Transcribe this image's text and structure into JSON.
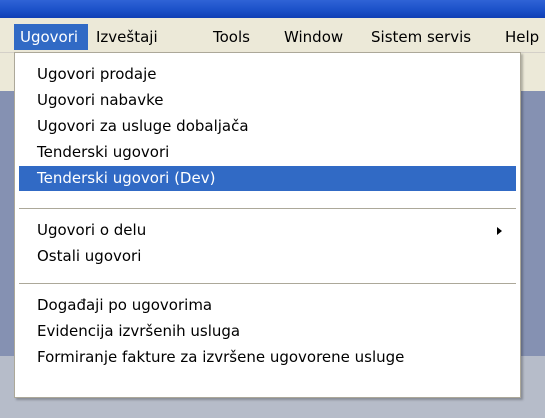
{
  "menubar": {
    "items": [
      {
        "label": "Ugovori",
        "active": true
      },
      {
        "label": "Izveštaji"
      },
      {
        "label": "Tools"
      },
      {
        "label": "Window"
      },
      {
        "label": "Sistem servis"
      },
      {
        "label": "Help"
      }
    ]
  },
  "dropdown": {
    "items": [
      {
        "label": "Ugovori prodaje"
      },
      {
        "label": "Ugovori nabavke"
      },
      {
        "label": "Ugovori za usluge dobaljača"
      },
      {
        "label": "Tenderski ugovori"
      },
      {
        "label": "Tenderski ugovori (Dev)",
        "highlighted": true
      },
      {
        "label": "Ugovori o delu",
        "submenu": true
      },
      {
        "label": "Ostali ugovori"
      },
      {
        "label": "Događaji po ugovorima"
      },
      {
        "label": "Evidencija izvršenih usluga"
      },
      {
        "label": "Formiranje fakture za izvršene ugovorene usluge"
      }
    ]
  },
  "colors": {
    "highlight": "#316ac5",
    "menu_bg": "#ece9d8",
    "workspace": "#8591b2"
  },
  "icons": {
    "submenu": "chevron-right-icon"
  }
}
